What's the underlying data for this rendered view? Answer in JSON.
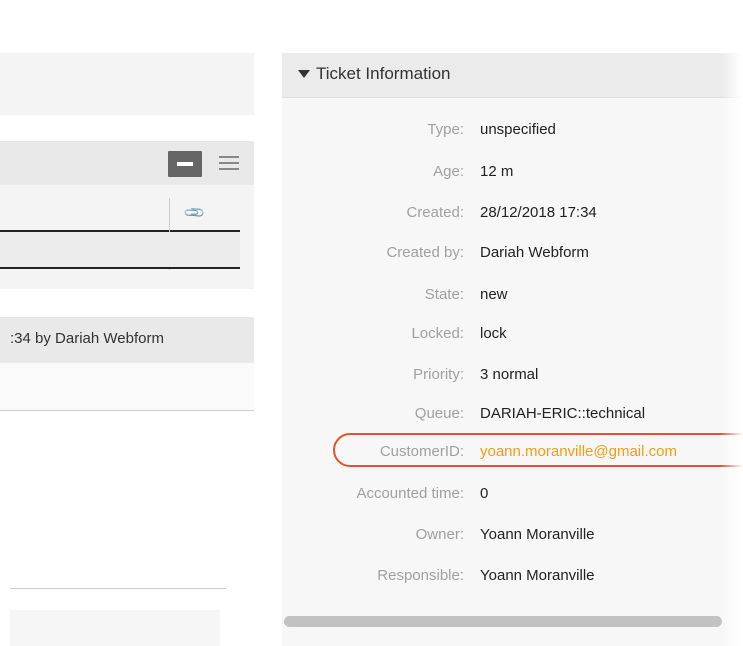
{
  "left": {
    "article_meta": ":34 by Dariah Webform"
  },
  "ticket_info": {
    "title": "Ticket Information",
    "rows": [
      {
        "label": "Type:",
        "value": "unspecified"
      },
      {
        "label": "Age:",
        "value": "12 m"
      },
      {
        "label": "Created:",
        "value": "28/12/2018 17:34"
      },
      {
        "label": "Created by:",
        "value": "Dariah Webform"
      },
      {
        "label": "State:",
        "value": "new"
      },
      {
        "label": "Locked:",
        "value": "lock"
      },
      {
        "label": "Priority:",
        "value": "3 normal"
      },
      {
        "label": "Queue:",
        "value": "DARIAH-ERIC::technical"
      },
      {
        "label": "CustomerID:",
        "value": "yoann.moranville@gmail.com"
      },
      {
        "label": "Accounted time:",
        "value": "0"
      },
      {
        "label": "Owner:",
        "value": "Yoann Moranville"
      },
      {
        "label": "Responsible:",
        "value": "Yoann Moranville"
      }
    ]
  },
  "colors": {
    "accent_link": "#f39c12",
    "highlight_ring": "#e0532b"
  },
  "icons": {
    "collapse": "caret-down-icon",
    "toggle": "minus-icon",
    "menu": "hamburger-menu-icon",
    "attachment": "paperclip-icon"
  }
}
